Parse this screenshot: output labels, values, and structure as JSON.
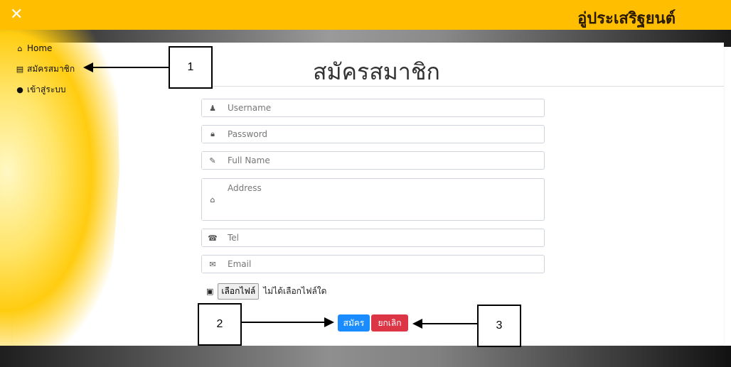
{
  "header": {
    "close_icon": "close-icon",
    "brand": "อู่ประเสริฐยนต์"
  },
  "sidebar": {
    "items": [
      {
        "icon": "home-icon",
        "label": "Home"
      },
      {
        "icon": "register-icon",
        "label": "สมัครสมาชิก"
      },
      {
        "icon": "user-icon",
        "label": "เข้าสู่ระบบ"
      }
    ]
  },
  "page": {
    "title": "สมัครสมาชิก"
  },
  "form": {
    "username": {
      "icon": "user-icon",
      "placeholder": "Username",
      "value": ""
    },
    "password": {
      "icon": "lock-icon",
      "placeholder": "Password",
      "value": ""
    },
    "fullname": {
      "icon": "edit-icon",
      "placeholder": "Full Name",
      "value": ""
    },
    "address": {
      "icon": "home-icon",
      "placeholder": "Address",
      "value": ""
    },
    "tel": {
      "icon": "phone-icon",
      "placeholder": "Tel",
      "value": ""
    },
    "email": {
      "icon": "envelope-icon",
      "placeholder": "Email",
      "value": ""
    },
    "file": {
      "icon": "camera-icon",
      "button_label": "เลือกไฟล์",
      "status": "ไม่ได้เลือกไฟล์ใด"
    },
    "submit_label": "สมัคร",
    "cancel_label": "ยกเลิก"
  },
  "annotations": [
    {
      "label": "1"
    },
    {
      "label": "2"
    },
    {
      "label": "3"
    }
  ],
  "colors": {
    "header": "#ffbf00",
    "primary": "#1a8cff",
    "danger": "#dc3545"
  }
}
